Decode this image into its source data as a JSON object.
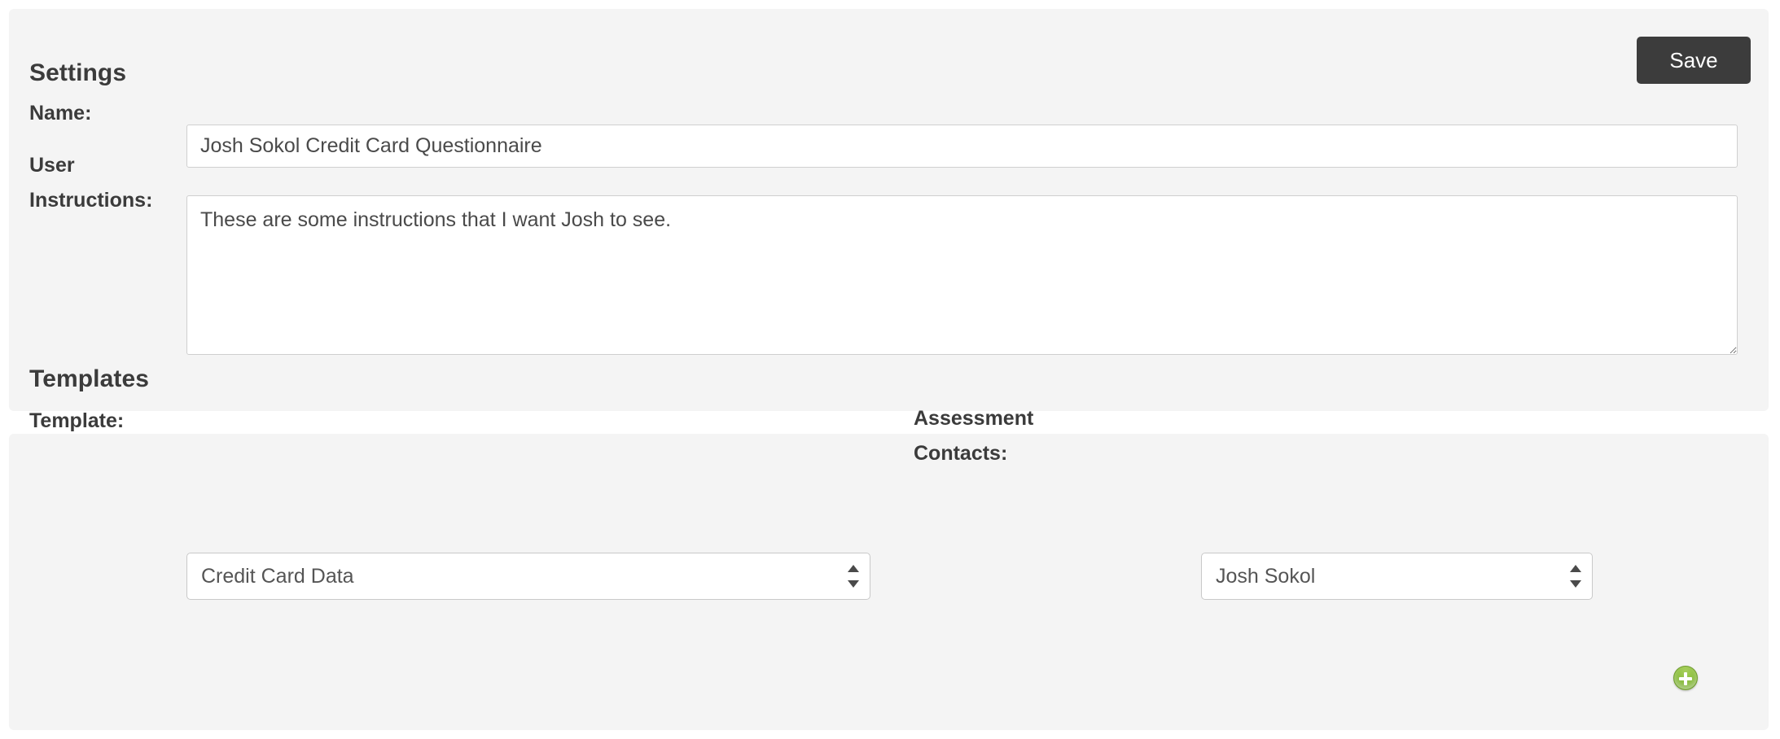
{
  "settings": {
    "heading": "Settings",
    "save_label": "Save",
    "name": {
      "label": "Name:",
      "value": "Josh Sokol Credit Card Questionnaire",
      "placeholder": ""
    },
    "user_instructions": {
      "label": "User Instructions:",
      "value": "These are some instructions that I want Josh to see.",
      "placeholder": ""
    }
  },
  "templates": {
    "heading": "Templates",
    "template": {
      "label": "Template:",
      "selected": "Credit Card Data"
    },
    "assessment_contacts": {
      "label": "Assessment Contacts:",
      "selected": "Josh Sokol",
      "add_button_icon": "plus-circle-icon"
    }
  },
  "colors": {
    "panel_background": "#f4f4f4",
    "page_background": "#ffffff",
    "save_button": "#3c3c3c",
    "text": "#3b3b3b",
    "input_border": "#cfcfcf",
    "add_button_green": "#8cbf3f"
  }
}
